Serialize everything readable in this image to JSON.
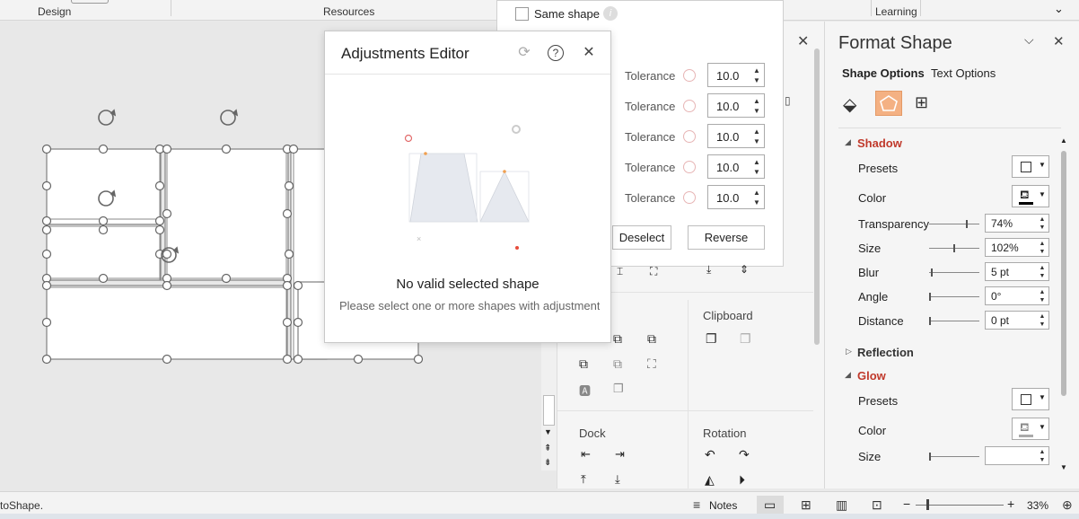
{
  "ribbon": {
    "groups": [
      "Design",
      "Resources",
      "Learning"
    ]
  },
  "popup": {
    "same_shape_label": "Same shape",
    "tolerance_label": "Tolerance",
    "tolerance_values": [
      "10.0",
      "10.0",
      "10.0",
      "10.0",
      "10.0"
    ],
    "deselect_label": "Deselect",
    "reverse_label": "Reverse"
  },
  "midpane": {
    "clipboard_label": "Clipboard",
    "dock_label": "Dock",
    "rotation_label": "Rotation"
  },
  "adjustments_editor": {
    "title": "Adjustments Editor",
    "message": "No valid selected shape",
    "submessage": "Please select one or more shapes with adjustment"
  },
  "format_shape": {
    "title": "Format Shape",
    "tab_shape_options": "Shape Options",
    "tab_text_options": "Text Options",
    "shadow": {
      "heading": "Shadow",
      "presets_label": "Presets",
      "color_label": "Color",
      "transparency_label": "Transparency",
      "transparency_value": "74%",
      "size_label": "Size",
      "size_value": "102%",
      "blur_label": "Blur",
      "blur_value": "5 pt",
      "angle_label": "Angle",
      "angle_value": "0°",
      "distance_label": "Distance",
      "distance_value": "0 pt"
    },
    "reflection_heading": "Reflection",
    "glow": {
      "heading": "Glow",
      "presets_label": "Presets",
      "color_label": "Color",
      "size_label": "Size",
      "size_value": ""
    }
  },
  "status": {
    "left_text": "toShape.",
    "notes_label": "Notes",
    "zoom": "33%"
  },
  "colors": {
    "accent": "#c0392b",
    "shape_tab_bg": "#f4b183"
  }
}
